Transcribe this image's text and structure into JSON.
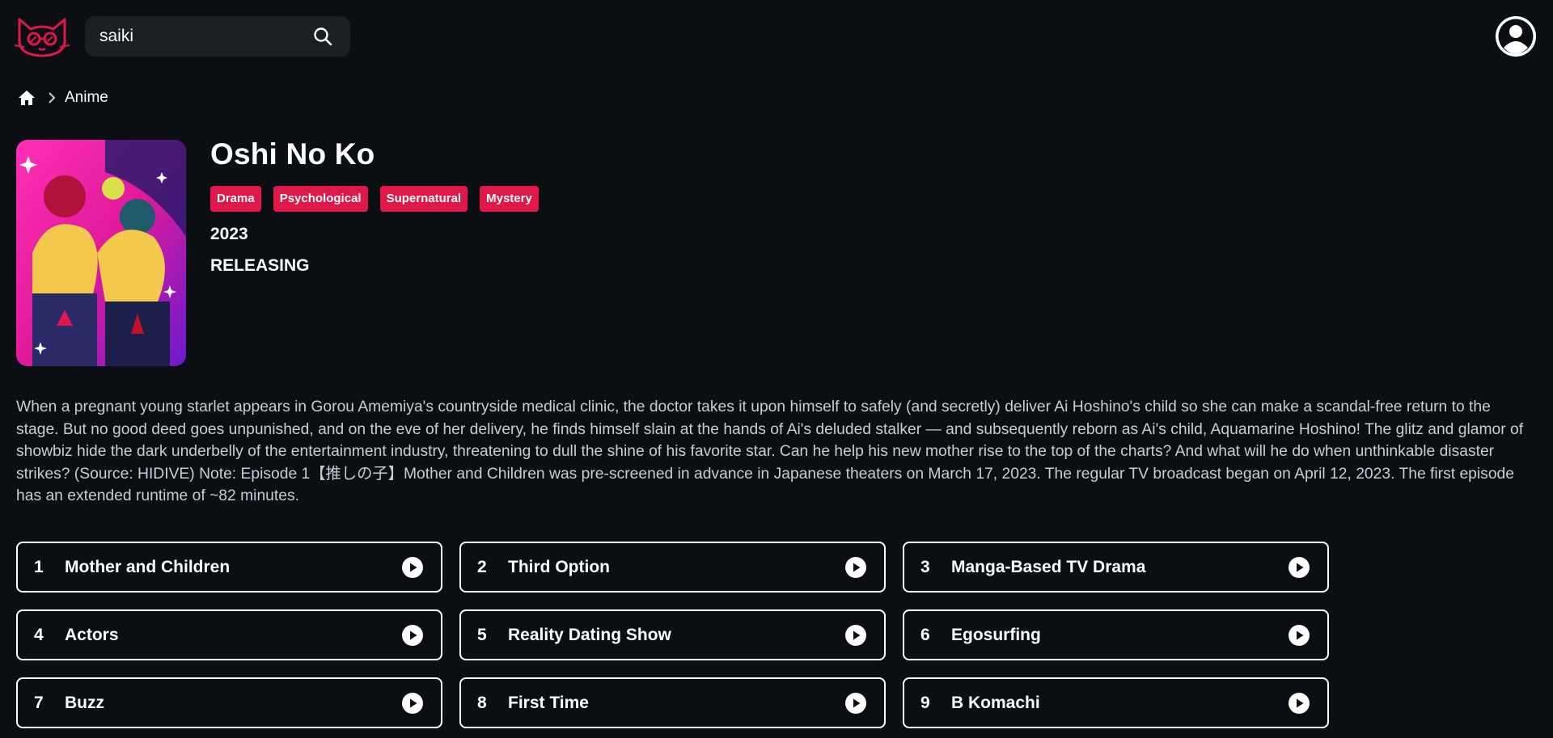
{
  "header": {
    "logo_icon": "cat-glasses-logo-icon",
    "search": {
      "value": "saiki",
      "placeholder": ""
    },
    "search_icon": "search-icon",
    "profile_icon": "user-circle-icon"
  },
  "breadcrumb": {
    "home_icon": "home-icon",
    "separator_icon": "chevron-right-icon",
    "current": "Anime"
  },
  "anime": {
    "title": "Oshi No Ko",
    "genres": [
      "Drama",
      "Psychological",
      "Supernatural",
      "Mystery"
    ],
    "year": "2023",
    "status": "RELEASING",
    "description": "When a pregnant young starlet appears in Gorou Amemiya's countryside medical clinic, the doctor takes it upon himself to safely (and secretly) deliver Ai Hoshino's child so she can make a scandal-free return to the stage. But no good deed goes unpunished, and on the eve of her delivery, he finds himself slain at the hands of Ai's deluded stalker — and subsequently reborn as Ai's child, Aquamarine Hoshino! The glitz and glamor of showbiz hide the dark underbelly of the entertainment industry, threatening to dull the shine of his favorite star. Can he help his new mother rise to the top of the charts? And what will he do when unthinkable disaster strikes? (Source: HIDIVE) Note: Episode 1【推しの子】Mother and Children was pre-screened in advance in Japanese theaters on March 17, 2023. The regular TV broadcast began on April 12, 2023. The first episode has an extended runtime of ~82 minutes."
  },
  "episodes": [
    {
      "number": "1",
      "title": "Mother and Children"
    },
    {
      "number": "2",
      "title": "Third Option"
    },
    {
      "number": "3",
      "title": "Manga-Based TV Drama"
    },
    {
      "number": "4",
      "title": "Actors"
    },
    {
      "number": "5",
      "title": "Reality Dating Show"
    },
    {
      "number": "6",
      "title": "Egosurfing"
    },
    {
      "number": "7",
      "title": "Buzz"
    },
    {
      "number": "8",
      "title": "First Time"
    },
    {
      "number": "9",
      "title": "B Komachi"
    }
  ],
  "colors": {
    "accent": "#e0174a",
    "background": "#0b0f14",
    "text_muted": "#c9cdd3"
  }
}
